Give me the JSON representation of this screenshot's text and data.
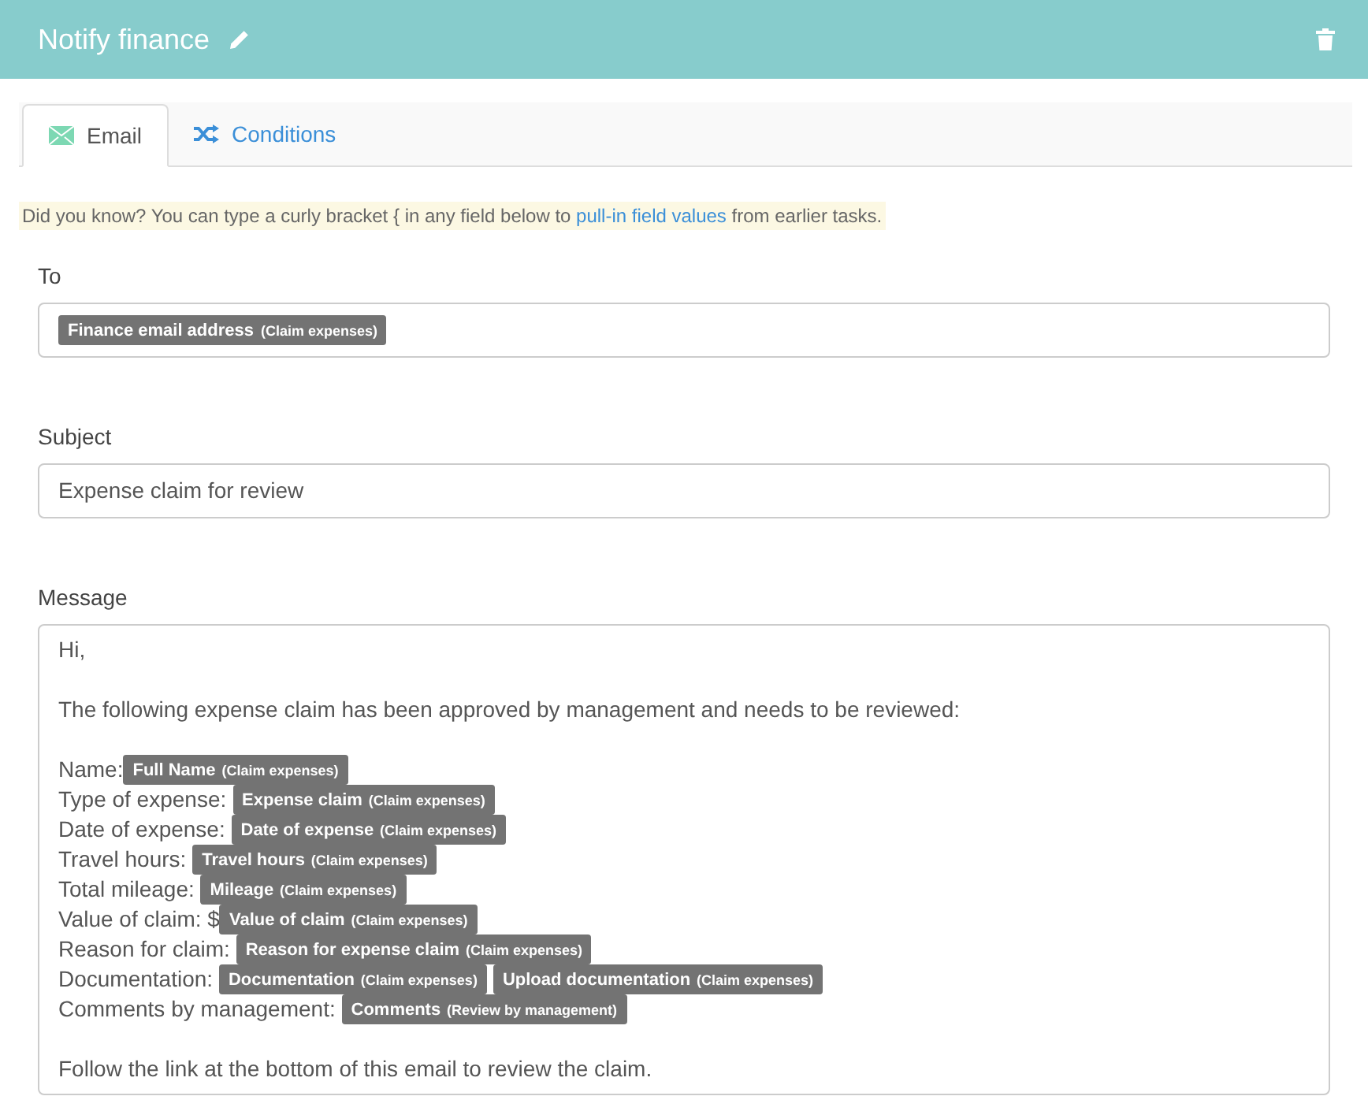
{
  "header": {
    "title": "Notify finance"
  },
  "tabs": [
    {
      "label": "Email",
      "selected": true,
      "kind": "email"
    },
    {
      "label": "Conditions",
      "selected": false,
      "kind": "conditions"
    }
  ],
  "hint": {
    "before": "Did you know? You can type a curly bracket { in any field below to",
    "link": "pull-in field values",
    "after": "from earlier tasks."
  },
  "to": {
    "label": "To",
    "tokens": [
      {
        "field": "Finance email address",
        "source": "(Claim expenses)"
      }
    ]
  },
  "subject": {
    "label": "Subject",
    "value": "Expense claim for review"
  },
  "message": {
    "label": "Message",
    "paragraphs": [
      {
        "lines": [
          {
            "parts": [
              {
                "text": "Hi,"
              }
            ]
          }
        ]
      },
      {
        "lines": [
          {
            "parts": [
              {
                "text": "The following expense claim has been approved by management and needs to be reviewed:"
              }
            ]
          }
        ]
      },
      {
        "lines": [
          {
            "parts": [
              {
                "text": "Name:"
              },
              {
                "field": "Full Name",
                "source": "(Claim expenses)"
              }
            ]
          },
          {
            "parts": [
              {
                "text": "Type of expense: "
              },
              {
                "field": "Expense claim",
                "source": "(Claim expenses)"
              }
            ]
          },
          {
            "parts": [
              {
                "text": "Date of expense: "
              },
              {
                "field": "Date of expense",
                "source": "(Claim expenses)"
              }
            ]
          },
          {
            "parts": [
              {
                "text": "Travel hours: "
              },
              {
                "field": "Travel hours",
                "source": "(Claim expenses)"
              }
            ]
          },
          {
            "parts": [
              {
                "text": "Total mileage: "
              },
              {
                "field": "Mileage",
                "source": "(Claim expenses)"
              }
            ]
          },
          {
            "parts": [
              {
                "text": "Value of claim: $"
              },
              {
                "field": "Value of claim",
                "source": "(Claim expenses)"
              }
            ]
          },
          {
            "parts": [
              {
                "text": "Reason for claim: "
              },
              {
                "field": "Reason for expense claim",
                "source": "(Claim expenses)"
              }
            ]
          },
          {
            "parts": [
              {
                "text": "Documentation: "
              },
              {
                "field": "Documentation",
                "source": "(Claim expenses)"
              },
              {
                "field": "Upload documentation",
                "source": "(Claim expenses)"
              }
            ]
          },
          {
            "parts": [
              {
                "text": "Comments by management: "
              },
              {
                "field": "Comments",
                "source": "(Review by management)"
              }
            ]
          }
        ]
      },
      {
        "lines": [
          {
            "parts": [
              {
                "text": "Follow the link at the bottom of this email to review the claim."
              }
            ]
          }
        ]
      }
    ]
  }
}
